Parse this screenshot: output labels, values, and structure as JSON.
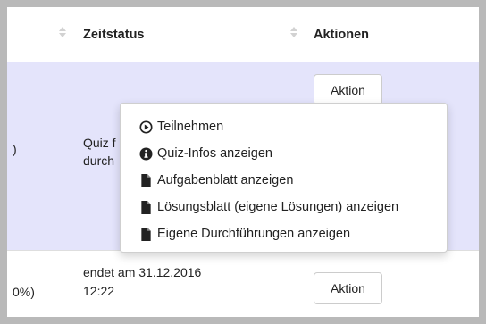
{
  "table": {
    "headers": {
      "zeitstatus": "Zeitstatus",
      "aktionen": "Aktionen"
    },
    "rows": [
      {
        "left_text": ")",
        "status_line1": "Quiz f",
        "status_line2": "durch",
        "action_label": "Aktion"
      },
      {
        "left_text": "0%)",
        "status_line1": "endet am 31.12.2016",
        "status_line2": "12:22",
        "action_label": "Aktion"
      }
    ]
  },
  "dropdown": {
    "items": [
      {
        "label": "Teilnehmen",
        "icon": "play-circle-icon"
      },
      {
        "label": "Quiz-Infos anzeigen",
        "icon": "info-circle-icon"
      },
      {
        "label": "Aufgabenblatt anzeigen",
        "icon": "file-icon"
      },
      {
        "label": "Lösungsblatt (eigene Lösungen) anzeigen",
        "icon": "file-icon"
      },
      {
        "label": "Eigene Durchführungen anzeigen",
        "icon": "file-icon"
      }
    ]
  },
  "colors": {
    "highlight_row": "#e4e4fb",
    "frame_border": "#b9b9b9",
    "text": "#222222"
  }
}
